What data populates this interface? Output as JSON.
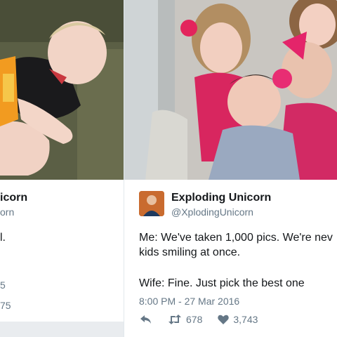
{
  "left_tweet": {
    "name_fragment": "icorn",
    "handle_fragment": "orn",
    "text_fragment": "l.",
    "meta_fragment_1": "5",
    "meta_fragment_2": "75"
  },
  "right_tweet": {
    "display_name": "Exploding Unicorn",
    "handle": "@XplodingUnicorn",
    "text_line_1": "Me: We've taken 1,000 pics. We're nev",
    "text_line_2": "kids smiling at once.",
    "text_line_3": "Wife: Fine. Just pick the best one",
    "timestamp": "8:00 PM - 27 Mar 2016",
    "retweet_count": "678",
    "like_count": "3,743",
    "icons": {
      "reply": "reply-icon",
      "retweet": "retweet-icon",
      "like": "heart-icon"
    }
  },
  "colors": {
    "text": "#14171a",
    "secondary": "#657786",
    "background": "#e9ecef"
  }
}
